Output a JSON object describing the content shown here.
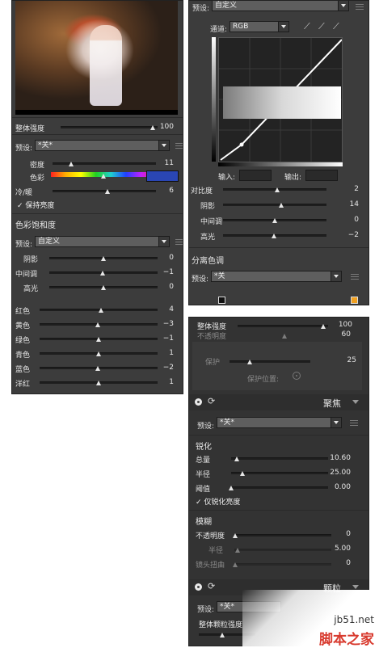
{
  "panel1": {
    "overall_label": "整体强度",
    "overall_value": "100",
    "overall_level": 0.95,
    "preset_label": "预设:",
    "preset_value": "*关*",
    "density_label": "密度",
    "density_value": "11",
    "density_level": 0.18,
    "color_label": "色彩",
    "color_swatch": "#2a46b4",
    "warmth_label": "冷/暖",
    "warmth_value": "6",
    "warmth_level": 0.53,
    "preserve_label": "保持亮度",
    "sat_title": "色彩饱和度",
    "sat_preset_label": "预设:",
    "sat_preset_value": "自定义",
    "tones": [
      {
        "label": "阴影",
        "value": "0",
        "level": 0.5
      },
      {
        "label": "中间调",
        "value": "−1",
        "level": 0.49
      },
      {
        "label": "高光",
        "value": "0",
        "level": 0.5
      }
    ],
    "colors": [
      {
        "label": "红色",
        "value": "4",
        "level": 0.52
      },
      {
        "label": "黄色",
        "value": "−3",
        "level": 0.49
      },
      {
        "label": "绿色",
        "value": "−1",
        "level": 0.5
      },
      {
        "label": "青色",
        "value": "1",
        "level": 0.5
      },
      {
        "label": "蓝色",
        "value": "−2",
        "level": 0.49
      },
      {
        "label": "洋红",
        "value": "1",
        "level": 0.5
      }
    ]
  },
  "panel2": {
    "preset_label": "预设:",
    "preset_value": "自定义",
    "channel_label": "通道:",
    "channel_value": "RGB",
    "input_label": "输入:",
    "output_label": "输出:",
    "sliders": [
      {
        "label": "对比度",
        "value": "2",
        "level": 0.52
      },
      {
        "label": "阴影",
        "value": "14",
        "level": 0.56
      },
      {
        "label": "中间调",
        "value": "0",
        "level": 0.5
      },
      {
        "label": "高光",
        "value": "−2",
        "level": 0.49
      }
    ],
    "split_title": "分离色调",
    "split_preset_label": "预设:",
    "split_preset_value": "*关",
    "shadow_swatch": "#111111",
    "highlight_swatch": "#f0a020"
  },
  "panel3": {
    "overall_label": "整体强度",
    "overall_value": "100",
    "overall_level": 0.95,
    "opacity_partial_label": "不透明度",
    "opacity_partial_value": "60",
    "protect_label": "保护",
    "protect_value": "25",
    "protect_level": 0.25,
    "protect_pos_label": "保护位置:",
    "focus_title": "聚焦",
    "preset_label": "预设:",
    "preset_value": "*关*",
    "sharpen_title": "锐化",
    "sharpen": [
      {
        "label": "总量",
        "value": "10.60",
        "level": 0.06
      },
      {
        "label": "半径",
        "value": "25.00",
        "level": 0.12
      },
      {
        "label": "阈值",
        "value": "0.00",
        "level": 0.0
      }
    ],
    "sharpen_luma_label": "仅锐化亮度",
    "blur_title": "模糊",
    "opacity_label": "不透明度",
    "opacity_value": "0",
    "radius_label": "半径",
    "radius_value": "5.00",
    "lens_label": "镜头扭曲",
    "lens_value": "0",
    "grain_title": "颗粒",
    "grain_preset_label": "预设:",
    "grain_preset_value": "*关*",
    "grain_overall_label": "整体颗粒强度"
  },
  "watermark": {
    "site": "jb51.net",
    "name": "脚本之家"
  }
}
